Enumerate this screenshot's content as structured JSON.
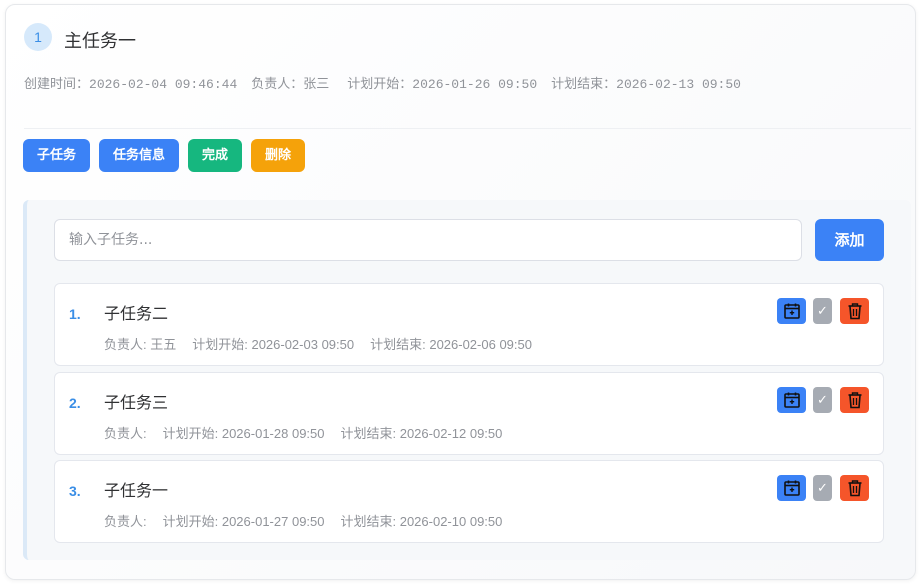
{
  "task": {
    "index": "1",
    "title": "主任务一",
    "meta": {
      "created_label": "创建时间：",
      "created_value": "2026-02-04 09:46:44",
      "owner_label": "负责人：",
      "owner_value": "张三",
      "plan_start_label": "计划开始：",
      "plan_start_value": "2026-01-26 09:50",
      "plan_end_label": "计划结束：",
      "plan_end_value": "2026-02-13 09:50"
    },
    "actions": {
      "subtask": "子任务",
      "info": "任务信息",
      "complete": "完成",
      "delete": "删除"
    }
  },
  "subtasks_panel": {
    "input_placeholder": "输入子任务...",
    "add_label": "添加",
    "items": [
      {
        "index": "1.",
        "name": "子任务二",
        "owner": "负责人: 王五",
        "start": "计划开始: 2026-02-03 09:50",
        "end": "计划结束: 2026-02-06 09:50"
      },
      {
        "index": "2.",
        "name": "子任务三",
        "owner": "负责人:",
        "start": "计划开始: 2026-01-28 09:50",
        "end": "计划结束: 2026-02-12 09:50"
      },
      {
        "index": "3.",
        "name": "子任务一",
        "owner": "负责人:",
        "start": "计划开始: 2026-01-27 09:50",
        "end": "计划结束: 2026-02-10 09:50"
      }
    ],
    "item_icons": [
      "calendar-icon",
      "check-icon",
      "trash-icon"
    ],
    "check_glyph": "✓"
  },
  "colors": {
    "primary": "#3b82f6",
    "success": "#16b77f",
    "warning": "#f5a20a",
    "danger": "#f5552a",
    "muted": "#a6abb3"
  }
}
